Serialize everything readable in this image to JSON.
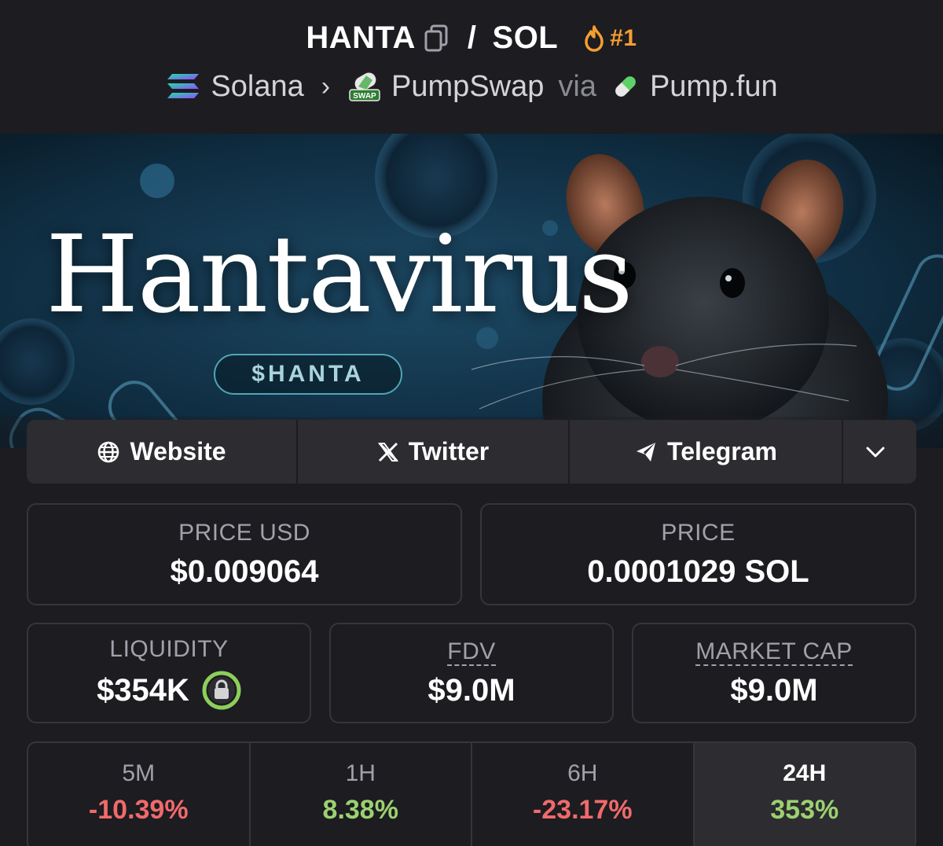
{
  "header": {
    "base_token": "HANTA",
    "quote_token": "SOL",
    "separator": "/",
    "rank": "#1",
    "chain": "Solana",
    "dex": "PumpSwap",
    "via": "via",
    "launchpad": "Pump.fun",
    "rank_color": "#f59e2f"
  },
  "banner": {
    "title": "Hantavirus",
    "ticker": "$HANTA"
  },
  "links": {
    "website": "Website",
    "twitter": "Twitter",
    "telegram": "Telegram"
  },
  "stats": {
    "price_usd_label": "PRICE USD",
    "price_usd": "$0.009064",
    "price_label": "PRICE",
    "price_sol": "0.0001029 SOL",
    "liquidity_label": "LIQUIDITY",
    "liquidity": "$354K",
    "fdv_label": "FDV",
    "fdv": "$9.0M",
    "mcap_label": "MARKET CAP",
    "mcap": "$9.0M"
  },
  "changes": [
    {
      "period": "5M",
      "value": "-10.39%",
      "direction": "down"
    },
    {
      "period": "1H",
      "value": "8.38%",
      "direction": "up"
    },
    {
      "period": "6H",
      "value": "-23.17%",
      "direction": "down"
    },
    {
      "period": "24H",
      "value": "353%",
      "direction": "up",
      "selected": true
    }
  ],
  "colors": {
    "negative": "#f06a6a",
    "positive": "#9bd16f",
    "background": "#1c1c21"
  }
}
